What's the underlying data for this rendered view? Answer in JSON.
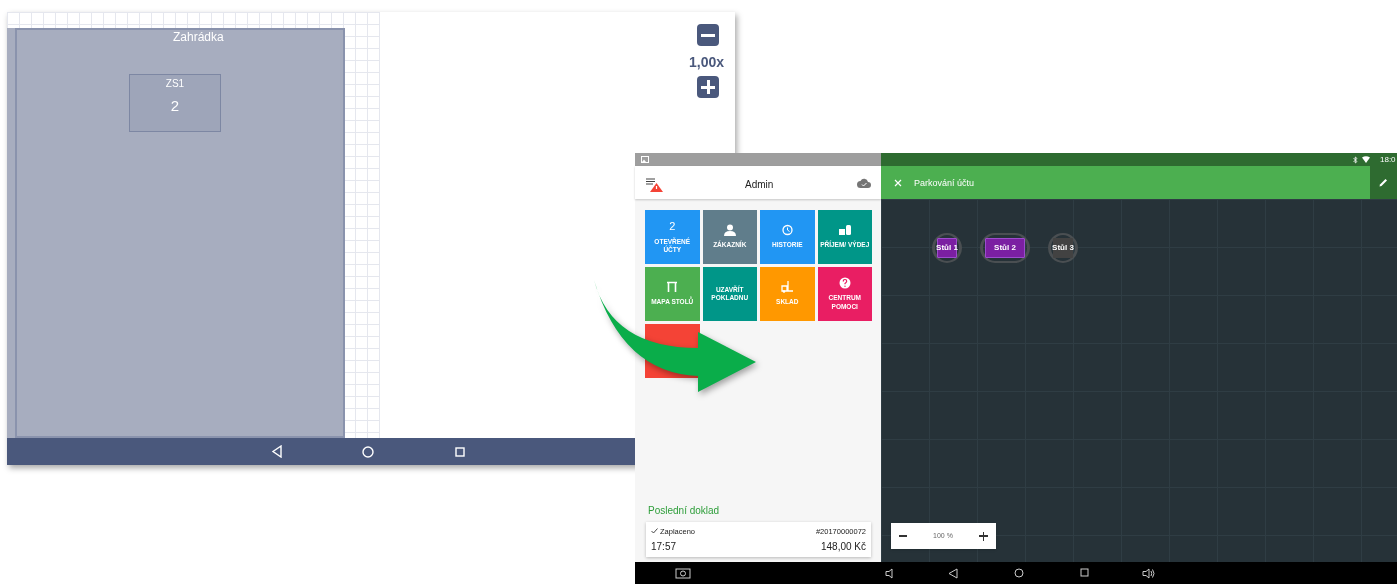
{
  "floor_editor": {
    "zone": {
      "title": "Zahrádka"
    },
    "table": {
      "name": "ZS1",
      "seats": "2"
    },
    "zoom": {
      "value": "1,00x"
    }
  },
  "pos_app": {
    "header": {
      "title": "Admin"
    },
    "tiles": [
      {
        "count": "2",
        "label": "OTEVŘENÉ ÚČTY",
        "kind": "plain",
        "color": "#2196f3"
      },
      {
        "label": "ZÁKAZNÍK",
        "kind": "person",
        "color": "#607d8b"
      },
      {
        "label": "HISTORIE",
        "kind": "history",
        "color": "#2196f3"
      },
      {
        "label": "PŘÍJEM/ VÝDEJ",
        "kind": "money",
        "color": "#009688"
      },
      {
        "label": "MAPA STOLŮ",
        "kind": "table",
        "color": "#4caf50"
      },
      {
        "label": "UZAVŘÍT POKLADNU",
        "kind": "plain",
        "color": "#009688"
      },
      {
        "label": "SKLAD",
        "kind": "forklift",
        "color": "#ff9800"
      },
      {
        "label": "CENTRUM POMOCI",
        "kind": "help",
        "color": "#e91e63"
      },
      {
        "kind": "plain",
        "color": "#f44336"
      }
    ],
    "last_receipt": {
      "heading": "Poslední doklad",
      "status": "Zaplaceno",
      "number": "#20170000072",
      "time": "17:57",
      "amount": "148,00 Kč"
    },
    "status_bar": {
      "time": "18:0"
    },
    "toolbar": {
      "title": "Parkování účtu"
    },
    "tables": [
      {
        "name": "Stůl 1",
        "kind": "small",
        "occupied": true
      },
      {
        "name": "Stůl 2",
        "kind": "wide",
        "occupied": true
      },
      {
        "name": "Stůl 3",
        "kind": "small",
        "occupied": false
      }
    ],
    "zoom": {
      "value": "100 %"
    }
  }
}
